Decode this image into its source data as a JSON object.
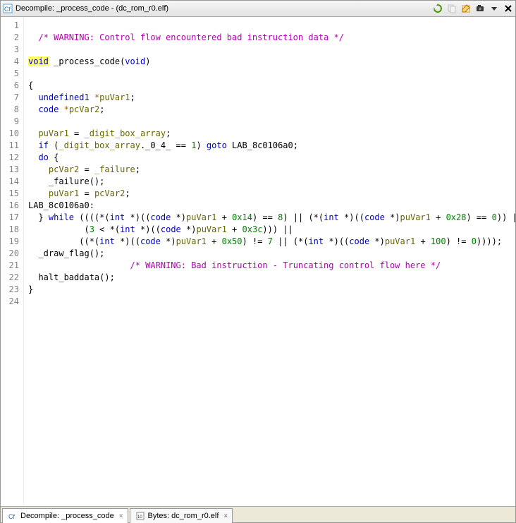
{
  "title": {
    "prefix": "Decompile: ",
    "func": "_process_code",
    "suffix": " - (dc_rom_r0.elf)"
  },
  "toolbar": {
    "icons": [
      "refresh-icon",
      "copy-icon",
      "edit-icon",
      "snapshot-icon",
      "menu-icon",
      "close-icon"
    ]
  },
  "lines": [
    {
      "n": 1,
      "t": "blank"
    },
    {
      "n": 2,
      "t": "cmt",
      "text": "/* WARNING: Control flow encountered bad instruction data */"
    },
    {
      "n": 3,
      "t": "blank"
    },
    {
      "n": 4,
      "t": "sig",
      "ret": "void",
      "name": "_process_code",
      "params": "void"
    },
    {
      "n": 5,
      "t": "blank"
    },
    {
      "n": 6,
      "t": "raw",
      "text": "{"
    },
    {
      "n": 7,
      "t": "decl",
      "type": "undefined1",
      "ptr": "*",
      "name": "puVar1"
    },
    {
      "n": 8,
      "t": "decl",
      "type": "code",
      "ptr": "*",
      "name": "pcVar2"
    },
    {
      "n": 9,
      "t": "blank"
    },
    {
      "n": 10,
      "t": "assign",
      "lhs": "puVar1",
      "rhs": "_digit_box_array"
    },
    {
      "n": 11,
      "t": "ifgoto",
      "cond_pre": "_digit_box_array",
      "cond_field": "._0_4_",
      "eq": "1",
      "label": "LAB_8c0106a0"
    },
    {
      "n": 12,
      "t": "do"
    },
    {
      "n": 13,
      "t": "assign2",
      "lhs": "pcVar2",
      "rhs": "_failure"
    },
    {
      "n": 14,
      "t": "call",
      "name": "_failure"
    },
    {
      "n": 15,
      "t": "assign3",
      "lhs": "puVar1",
      "rhs": "pcVar2"
    },
    {
      "n": 16,
      "t": "label",
      "name": "LAB_8c0106a0"
    },
    {
      "n": 17,
      "t": "while1",
      "a": "0x14",
      "v1": "8",
      "b": "0x28",
      "v2": "0"
    },
    {
      "n": 18,
      "t": "while2",
      "a": "3",
      "b": "0x3c"
    },
    {
      "n": 19,
      "t": "while3",
      "a": "0x50",
      "v1": "7",
      "b": "100",
      "v2": "0"
    },
    {
      "n": 20,
      "t": "call0",
      "name": "_draw_flag"
    },
    {
      "n": 21,
      "t": "cmt2",
      "text": "/* WARNING: Bad instruction - Truncating control flow here */"
    },
    {
      "n": 22,
      "t": "call0",
      "name": "halt_baddata"
    },
    {
      "n": 23,
      "t": "raw",
      "text": "}"
    },
    {
      "n": 24,
      "t": "blank"
    }
  ],
  "tabs": [
    {
      "icon": "cf",
      "label": "Decompile: _process_code",
      "active": true
    },
    {
      "icon": "bytes",
      "label": "Bytes: dc_rom_r0.elf",
      "active": false
    }
  ]
}
